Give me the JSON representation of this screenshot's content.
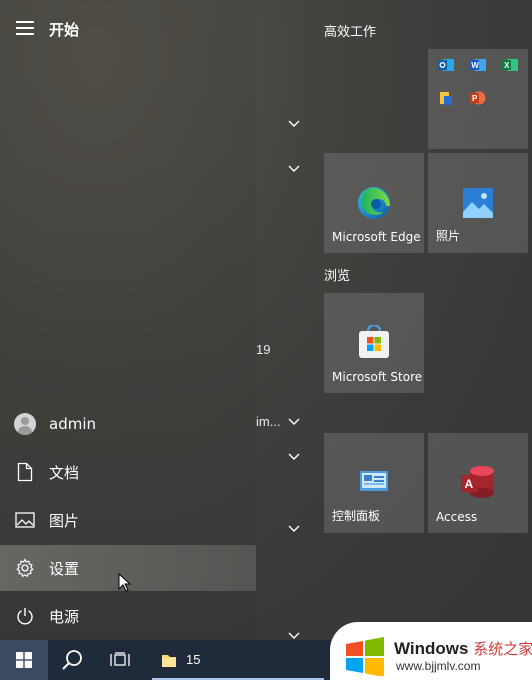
{
  "start_menu": {
    "title": "开始",
    "rail_items": [
      {
        "label": "admin",
        "icon": "user-avatar-icon"
      },
      {
        "label": "文档",
        "icon": "document-icon"
      },
      {
        "label": "图片",
        "icon": "picture-icon"
      },
      {
        "label": "设置",
        "icon": "gear-icon"
      },
      {
        "label": "电源",
        "icon": "power-icon"
      }
    ]
  },
  "app_list_fragments": {
    "text_19": "19",
    "text_im": "im..."
  },
  "tiles": {
    "group1_title": "高效工作",
    "group2_title": "浏览",
    "office_tile_icons": [
      "outlook-icon",
      "word-icon",
      "excel-icon",
      "onenote-files-icon",
      "powerpoint-icon"
    ],
    "edge": {
      "label": "Microsoft Edge",
      "icon": "edge-icon"
    },
    "photos": {
      "label": "照片",
      "icon": "photos-icon"
    },
    "store": {
      "label": "Microsoft Store",
      "icon": "store-icon"
    },
    "control_panel": {
      "label": "控制面板",
      "icon": "control-panel-icon"
    },
    "access": {
      "label": "Access",
      "icon": "access-icon"
    }
  },
  "taskbar": {
    "explorer_count": "15",
    "icons": [
      "windows-start-icon",
      "search-icon",
      "task-view-icon",
      "file-explorer-icon"
    ]
  },
  "watermark": {
    "title": "Windows",
    "title_cn": "系统之家",
    "url": "www.bjjmlv.com"
  },
  "colors": {
    "taskbar": "#1f2a3a",
    "tile": "#6e6e6e",
    "accent_blue": "#0078d4"
  }
}
